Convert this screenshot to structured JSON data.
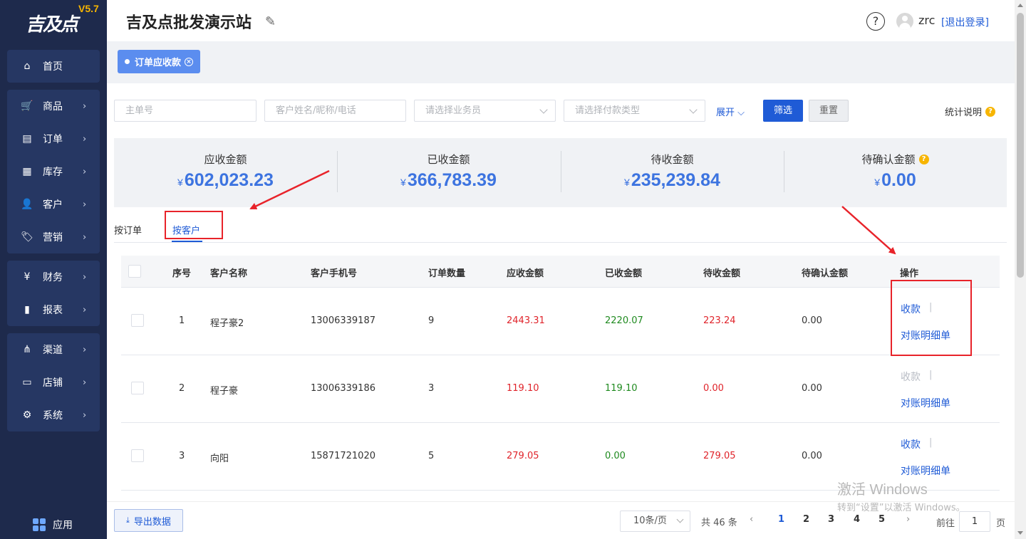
{
  "app": {
    "logo_text": "吉及点",
    "version": "V5.7",
    "store_name": "吉及点批发演示站",
    "help_symbol": "?",
    "username": "zrc",
    "logout_label": "[退出登录]"
  },
  "sidebar": {
    "groups": [
      [
        {
          "label": "首页",
          "icon": "home-icon",
          "glyph": "⌂",
          "chevron": false
        }
      ],
      [
        {
          "label": "商品",
          "icon": "cart-icon",
          "glyph": "🛒",
          "chevron": true
        },
        {
          "label": "订单",
          "icon": "order-icon",
          "glyph": "▤",
          "chevron": true
        },
        {
          "label": "库存",
          "icon": "inventory-icon",
          "glyph": "▦",
          "chevron": true
        },
        {
          "label": "客户",
          "icon": "customer-icon",
          "glyph": "👤",
          "chevron": true
        },
        {
          "label": "营销",
          "icon": "tag-icon",
          "glyph": "🏷",
          "chevron": true
        }
      ],
      [
        {
          "label": "财务",
          "icon": "finance-icon",
          "glyph": "¥",
          "chevron": true
        },
        {
          "label": "报表",
          "icon": "chart-icon",
          "glyph": "▮",
          "chevron": true
        }
      ],
      [
        {
          "label": "渠道",
          "icon": "channel-icon",
          "glyph": "⋔",
          "chevron": true
        },
        {
          "label": "店铺",
          "icon": "store-icon",
          "glyph": "▭",
          "chevron": true
        },
        {
          "label": "系统",
          "icon": "gear-icon",
          "glyph": "⚙",
          "chevron": true
        }
      ]
    ],
    "app_label": "应用"
  },
  "tabs": {
    "active_label": "订单应收款",
    "close_symbol": "×"
  },
  "filters": {
    "order_no_placeholder": "主单号",
    "customer_placeholder": "客户姓名/昵称/电话",
    "salesman_placeholder": "请选择业务员",
    "payment_type_placeholder": "请选择付款类型",
    "expand_label": "展开",
    "filter_button": "筛选",
    "reset_button": "重置",
    "stats_info_label": "统计说明",
    "q_symbol": "?"
  },
  "summary": {
    "currency": "¥",
    "receivable": {
      "label": "应收金额",
      "value": "602,023.23"
    },
    "received": {
      "label": "已收金额",
      "value": "366,783.39"
    },
    "pending": {
      "label": "待收金额",
      "value": "235,239.84"
    },
    "to_confirm": {
      "label": "待确认金额",
      "value": "0.00"
    }
  },
  "view_tabs": {
    "by_order": "按订单",
    "by_customer": "按客户"
  },
  "table": {
    "columns": [
      "序号",
      "客户名称",
      "客户手机号",
      "订单数量",
      "应收金额",
      "已收金额",
      "待收金额",
      "待确认金额",
      "操作"
    ],
    "rows": [
      {
        "index": "1",
        "name": "程子豪2",
        "phone": "13006339187",
        "orders": "9",
        "receivable": "2443.31",
        "received": "2220.07",
        "pending": "223.24",
        "to_confirm": "0.00",
        "collect": "收款",
        "collect_enabled": true,
        "detail": "对账明细单"
      },
      {
        "index": "2",
        "name": "程子豪",
        "phone": "13006339186",
        "orders": "3",
        "receivable": "119.10",
        "received": "119.10",
        "pending": "0.00",
        "to_confirm": "0.00",
        "collect": "收款",
        "collect_enabled": false,
        "detail": "对账明细单"
      },
      {
        "index": "3",
        "name": "向阳",
        "phone": "15871721020",
        "orders": "5",
        "receivable": "279.05",
        "received": "0.00",
        "pending": "279.05",
        "to_confirm": "0.00",
        "collect": "收款",
        "collect_enabled": true,
        "detail": "对账明细单"
      }
    ],
    "separator": "|"
  },
  "footer": {
    "export_label": "导出数据",
    "page_size": "10条/页",
    "total": "共 46 条",
    "pages": [
      "1",
      "2",
      "3",
      "4",
      "5"
    ],
    "current_page": "1",
    "goto_label": "前往",
    "goto_value": "1",
    "goto_suffix": "页"
  },
  "watermark": {
    "line1": "激活 Windows",
    "line2": "转到“设置”以激活 Windows。"
  },
  "colors": {
    "sidebar_bg": "#1e2a4c",
    "accent": "#1f5bd6",
    "amount_blue": "#3d74e0",
    "red": "#e0242b",
    "green": "#1f8a1f",
    "annotation": "#e8232a"
  }
}
